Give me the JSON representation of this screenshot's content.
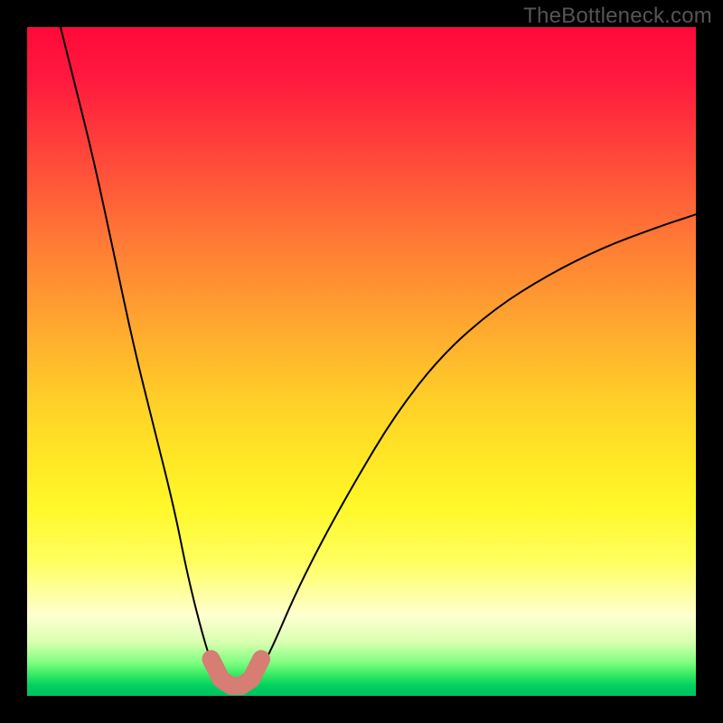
{
  "watermark": "TheBottleneck.com",
  "chart_data": {
    "type": "line",
    "title": "",
    "xlabel": "",
    "ylabel": "",
    "xlim": [
      0,
      100
    ],
    "ylim": [
      0,
      100
    ],
    "grid": false,
    "legend": false,
    "background_gradient": {
      "top": "#ff0a3a",
      "mid_upper": "#ffa92f",
      "mid_lower": "#fff82a",
      "bottom": "#00c060",
      "meaning": "heatmap-like vertical gradient, red=high, green=low"
    },
    "series": [
      {
        "name": "curve",
        "stroke": "#000000",
        "stroke_width": 2,
        "points": [
          {
            "x": 5,
            "y": 100
          },
          {
            "x": 7,
            "y": 92
          },
          {
            "x": 10,
            "y": 80
          },
          {
            "x": 13,
            "y": 66
          },
          {
            "x": 16,
            "y": 52
          },
          {
            "x": 19,
            "y": 40
          },
          {
            "x": 22,
            "y": 28
          },
          {
            "x": 24,
            "y": 18
          },
          {
            "x": 26,
            "y": 10
          },
          {
            "x": 27.5,
            "y": 5
          },
          {
            "x": 29,
            "y": 2
          },
          {
            "x": 30.5,
            "y": 1
          },
          {
            "x": 32,
            "y": 1
          },
          {
            "x": 33.5,
            "y": 2
          },
          {
            "x": 35,
            "y": 4
          },
          {
            "x": 37,
            "y": 8
          },
          {
            "x": 40,
            "y": 15
          },
          {
            "x": 44,
            "y": 23
          },
          {
            "x": 49,
            "y": 32
          },
          {
            "x": 55,
            "y": 42
          },
          {
            "x": 62,
            "y": 51
          },
          {
            "x": 70,
            "y": 58
          },
          {
            "x": 78,
            "y": 63
          },
          {
            "x": 86,
            "y": 67
          },
          {
            "x": 94,
            "y": 70
          },
          {
            "x": 100,
            "y": 72
          }
        ]
      }
    ],
    "highlight": {
      "name": "valley-segment",
      "stroke": "#d67d74",
      "stroke_width": 20,
      "points": [
        {
          "x": 27.5,
          "y": 5.5
        },
        {
          "x": 29,
          "y": 2.5
        },
        {
          "x": 30.5,
          "y": 1.5
        },
        {
          "x": 32,
          "y": 1.5
        },
        {
          "x": 33.5,
          "y": 2.5
        },
        {
          "x": 35,
          "y": 5.5
        }
      ]
    }
  }
}
